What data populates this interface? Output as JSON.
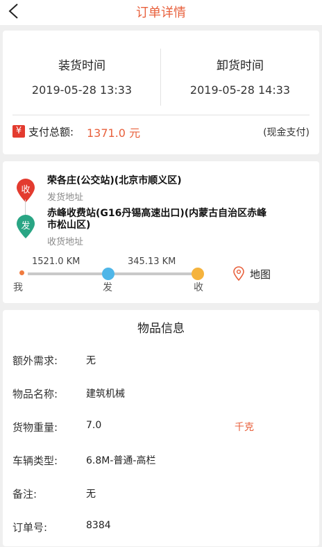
{
  "header": {
    "title": "订单详情"
  },
  "times": {
    "load_label": "装货时间",
    "load_value": "2019-05-28 13:33",
    "unload_label": "卸货时间",
    "unload_value": "2019-05-28 14:33"
  },
  "payment": {
    "icon_glyph": "¥",
    "label": "支付总额:",
    "amount": "1371.0 元",
    "method": "(现金支付)"
  },
  "route": {
    "origin_pin": "收",
    "origin_name": "荣各庄(公交站)(北京市顺义区)",
    "origin_type": "发货地址",
    "dest_pin": "发",
    "dest_name": "赤峰收费站(G16丹锡高速出口)(内蒙古自治区赤峰市松山区)",
    "dest_type": "收货地址",
    "distance_to_origin": "1521.0 KM",
    "distance_to_dest": "345.13 KM",
    "track_me": "我",
    "track_from": "发",
    "track_to": "收",
    "map_label": "地图",
    "colors": {
      "origin_pin": "#e33b2f",
      "dest_pin": "#29a584",
      "accent": "#e8603c"
    }
  },
  "goods": {
    "title": "物品信息",
    "rows": [
      {
        "label": "额外需求:",
        "value": "无"
      },
      {
        "label": "物品名称:",
        "value": "建筑机械"
      },
      {
        "label": "货物重量:",
        "value": "7.0",
        "unit": "千克"
      },
      {
        "label": "车辆类型:",
        "value": "6.8M-普通-高栏"
      },
      {
        "label": "备注:",
        "value": "无"
      },
      {
        "label": "订单号:",
        "value": "8384"
      }
    ]
  }
}
